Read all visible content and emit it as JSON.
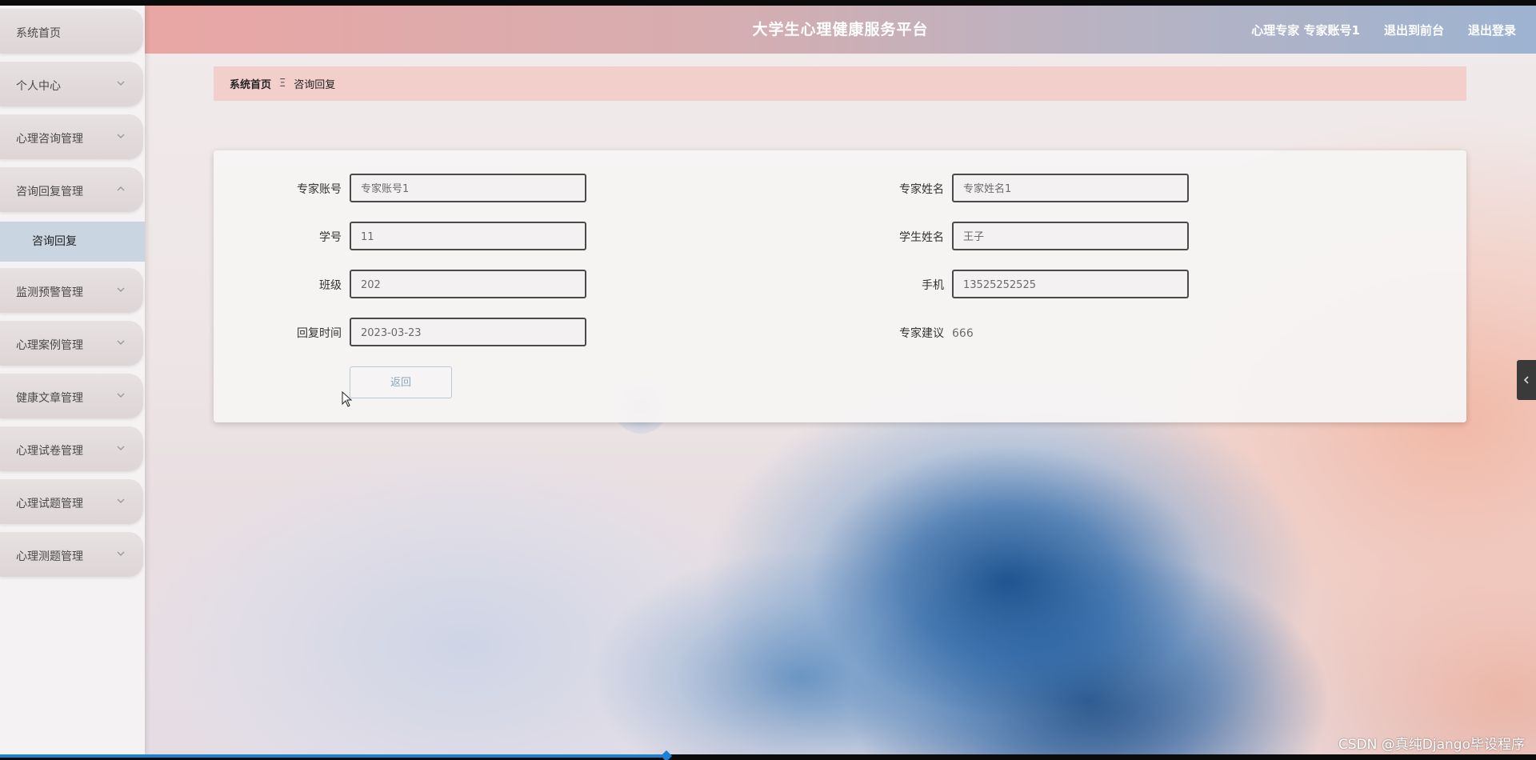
{
  "header": {
    "title": "大学生心理健康服务平台",
    "user_label": "心理专家 专家账号1",
    "goto_front": "退出到前台",
    "logout": "退出登录"
  },
  "sidebar": {
    "items": [
      {
        "label": "系统首页",
        "has_chevron": false
      },
      {
        "label": "个人中心",
        "has_chevron": true
      },
      {
        "label": "心理咨询管理",
        "has_chevron": true
      },
      {
        "label": "咨询回复管理",
        "has_chevron": true,
        "expanded": true
      },
      {
        "label": "监测预警管理",
        "has_chevron": true
      },
      {
        "label": "心理案例管理",
        "has_chevron": true
      },
      {
        "label": "健康文章管理",
        "has_chevron": true
      },
      {
        "label": "心理试卷管理",
        "has_chevron": true
      },
      {
        "label": "心理试题管理",
        "has_chevron": true
      },
      {
        "label": "心理测题管理",
        "has_chevron": true
      }
    ],
    "active_subitem": "咨询回复"
  },
  "breadcrumb": {
    "home": "系统首页",
    "separator": "Ξ",
    "current": "咨询回复"
  },
  "form": {
    "expert_account": {
      "label": "专家账号",
      "value": "专家账号1"
    },
    "expert_name": {
      "label": "专家姓名",
      "value": "专家姓名1"
    },
    "student_no": {
      "label": "学号",
      "value": "11"
    },
    "student_name": {
      "label": "学生姓名",
      "value": "王子"
    },
    "class": {
      "label": "班级",
      "value": "202"
    },
    "phone": {
      "label": "手机",
      "value": "13525252525"
    },
    "reply_time": {
      "label": "回复时间",
      "value": "2023-03-23"
    },
    "advice": {
      "label": "专家建议",
      "value": "666"
    },
    "back_button": "返回"
  },
  "watermark": "CSDN @真纯Django毕设程序",
  "video_progress": 0.434,
  "colors": {
    "breadcrumb_bg": "#f2cfcb",
    "submenu_active_bg": "#c9d6e2",
    "progress": "#1e7fd6"
  }
}
